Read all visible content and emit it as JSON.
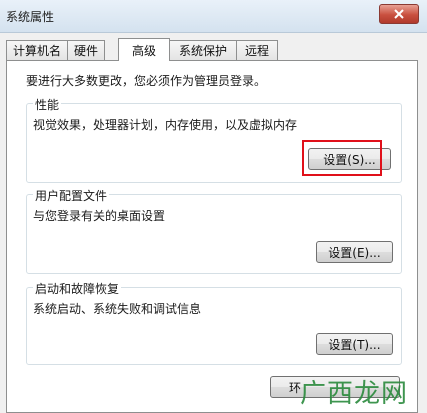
{
  "window": {
    "title": "系统属性"
  },
  "tabs": [
    {
      "label": "计算机名"
    },
    {
      "label": "硬件"
    },
    {
      "label": "高级",
      "active": true
    },
    {
      "label": "系统保护"
    },
    {
      "label": "远程"
    }
  ],
  "advanced": {
    "notice": "要进行大多数更改，您必须作为管理员登录。",
    "performance": {
      "title": "性能",
      "description": "视觉效果，处理器计划，内存使用，以及虚拟内存",
      "settings_label": "设置(S)..."
    },
    "user_profiles": {
      "title": "用户配置文件",
      "description": "与您登录有关的桌面设置",
      "settings_label": "设置(E)..."
    },
    "startup_recovery": {
      "title": "启动和故障恢复",
      "description": "系统启动、系统失败和调试信息",
      "settings_label": "设置(T)..."
    },
    "env_button_partial": "环"
  },
  "watermark": {
    "text": "广西龙网"
  },
  "colors": {
    "highlight": "#e0101a",
    "close_button": "#c9503f"
  }
}
